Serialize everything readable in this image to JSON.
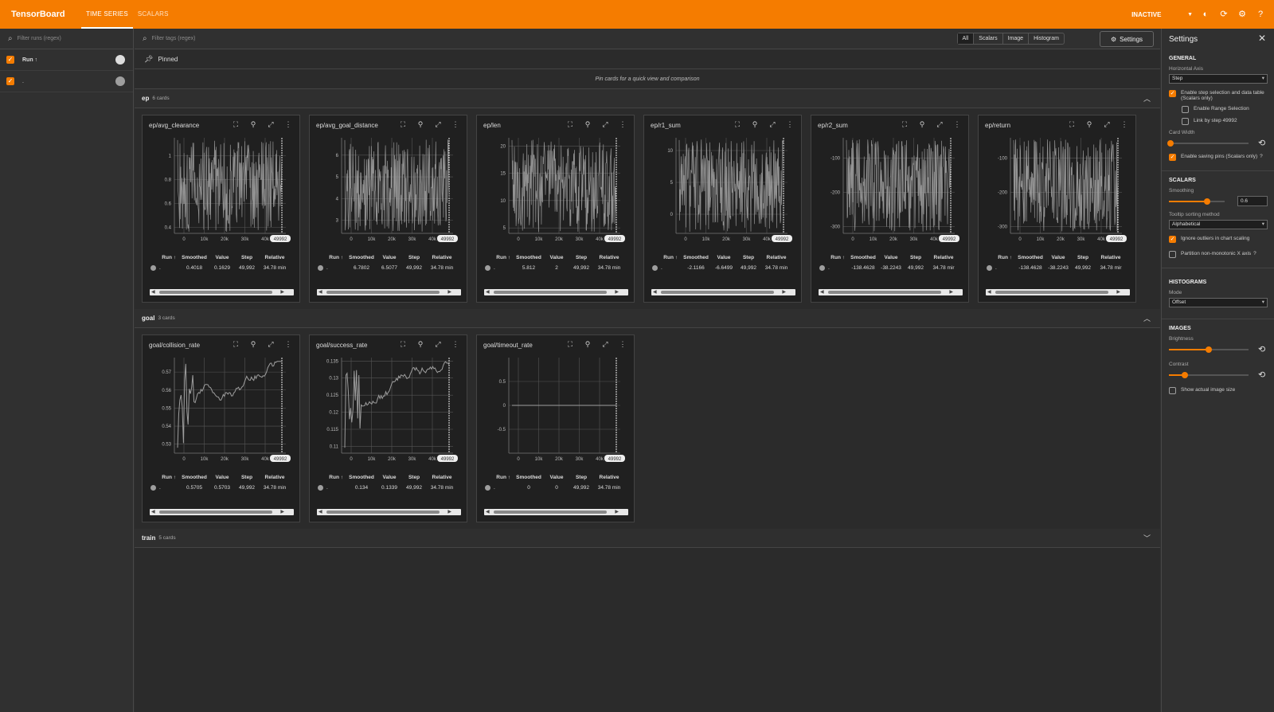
{
  "app": {
    "brand": "TensorBoard",
    "tabs": [
      "TIME SERIES",
      "SCALARS"
    ],
    "status": "INACTIVE"
  },
  "colors": {
    "accent": "#f57c00",
    "line": "#9e9e9e"
  },
  "runs_panel": {
    "filter_placeholder": "Filter runs (regex)",
    "header_label": "Run ↑",
    "runs": [
      {
        "name": "."
      }
    ]
  },
  "tag_filter": {
    "placeholder": "Filter tags (regex)",
    "type_buttons": [
      "All",
      "Scalars",
      "Image",
      "Histogram"
    ],
    "settings_label": "Settings"
  },
  "pinned": {
    "title": "Pinned",
    "empty_text": "Pin cards for a quick view and comparison"
  },
  "stat_headers": [
    "Run ↑",
    "Smoothed",
    "Value",
    "Step",
    "Relative"
  ],
  "groups": [
    {
      "name": "ep",
      "count": "6 cards",
      "expanded": true,
      "cards": [
        {
          "title": "ep/avg_clearance",
          "y_ticks": [
            "1",
            "0.8",
            "0.6",
            "0.4"
          ],
          "ylim": [
            0.35,
            1.15
          ],
          "stats": {
            "run": ".",
            "smoothed": "0.4018",
            "value": "0.1629",
            "step": "49,992",
            "relative": "34.78 min"
          }
        },
        {
          "title": "ep/avg_goal_distance",
          "y_ticks": [
            "6",
            "5",
            "4",
            "3"
          ],
          "ylim": [
            2.4,
            6.8
          ],
          "stats": {
            "run": ".",
            "smoothed": "6.7802",
            "value": "6.5077",
            "step": "49,992",
            "relative": "34.78 min"
          }
        },
        {
          "title": "ep/len",
          "y_ticks": [
            "20",
            "15",
            "10",
            "5"
          ],
          "ylim": [
            4,
            21.5
          ],
          "stats": {
            "run": ".",
            "smoothed": "5.812",
            "value": "2",
            "step": "49,992",
            "relative": "34.78 min"
          }
        },
        {
          "title": "ep/r1_sum",
          "y_ticks": [
            "10",
            "5",
            "0"
          ],
          "ylim": [
            -3,
            12
          ],
          "stats": {
            "run": ".",
            "smoothed": "-2.1166",
            "value": "-6.6499",
            "step": "49,992",
            "relative": "34.78 min"
          }
        },
        {
          "title": "ep/r2_sum",
          "y_ticks": [
            "-100",
            "-200",
            "-300"
          ],
          "ylim": [
            -320,
            -40
          ],
          "stats": {
            "run": ".",
            "smoothed": "-138.4628",
            "value": "-38.2243",
            "step": "49,992",
            "relative": "34.78 mir"
          }
        },
        {
          "title": "ep/return",
          "y_ticks": [
            "-100",
            "-200",
            "-300"
          ],
          "ylim": [
            -320,
            -40
          ],
          "stats": {
            "run": ".",
            "smoothed": "-138.4628",
            "value": "-38.2243",
            "step": "49,992",
            "relative": "34.78 mir"
          }
        }
      ]
    },
    {
      "name": "goal",
      "count": "3 cards",
      "expanded": true,
      "cards": [
        {
          "title": "goal/collision_rate",
          "y_ticks": [
            "0.57",
            "0.56",
            "0.55",
            "0.54",
            "0.53"
          ],
          "ylim": [
            0.525,
            0.578
          ],
          "stats": {
            "run": ".",
            "smoothed": "0.5705",
            "value": "0.5703",
            "step": "49,992",
            "relative": "34.78 min"
          }
        },
        {
          "title": "goal/success_rate",
          "y_ticks": [
            "0.135",
            "0.13",
            "0.125",
            "0.12",
            "0.115",
            "0.11"
          ],
          "ylim": [
            0.108,
            0.136
          ],
          "stats": {
            "run": ".",
            "smoothed": "0.134",
            "value": "0.1339",
            "step": "49,992",
            "relative": "34.78 min"
          }
        },
        {
          "title": "goal/timeout_rate",
          "y_ticks": [
            "0.5",
            "0",
            "-0.5"
          ],
          "ylim": [
            -1,
            1
          ],
          "stats": {
            "run": ".",
            "smoothed": "0",
            "value": "0",
            "step": "49,992",
            "relative": "34.78 min"
          }
        }
      ]
    },
    {
      "name": "train",
      "count": "5 cards",
      "expanded": false,
      "cards": []
    }
  ],
  "x_ticks": [
    "0",
    "10k",
    "20k",
    "30k",
    "40k"
  ],
  "x_end_label": "49992",
  "settings_panel": {
    "title": "Settings",
    "general": {
      "heading": "GENERAL",
      "horizontal_axis_label": "Horizontal Axis",
      "horizontal_axis_value": "Step",
      "enable_step_selection": "Enable step selection and data table",
      "scalars_only": "(Scalars only)",
      "enable_range": "Enable Range Selection",
      "link_by_step": "Link by step 49992",
      "card_width_label": "Card Width",
      "card_width_level": 0.0,
      "saving_pins": "Enable saving pins (Scalars only)"
    },
    "scalars": {
      "heading": "SCALARS",
      "smoothing_label": "Smoothing",
      "smoothing_value": "0.6",
      "tooltip_label": "Tooltip sorting method",
      "tooltip_value": "Alphabetical",
      "ignore_outliers": "Ignore outliers in chart scaling",
      "partition": "Partition non-monotonic X axis"
    },
    "histograms": {
      "heading": "HISTOGRAMS",
      "mode_label": "Mode",
      "mode_value": "Offset"
    },
    "images": {
      "heading": "IMAGES",
      "brightness_label": "Brightness",
      "brightness_level": 0.5,
      "contrast_label": "Contrast",
      "contrast_level": 0.2,
      "actual_size": "Show actual image size"
    }
  }
}
